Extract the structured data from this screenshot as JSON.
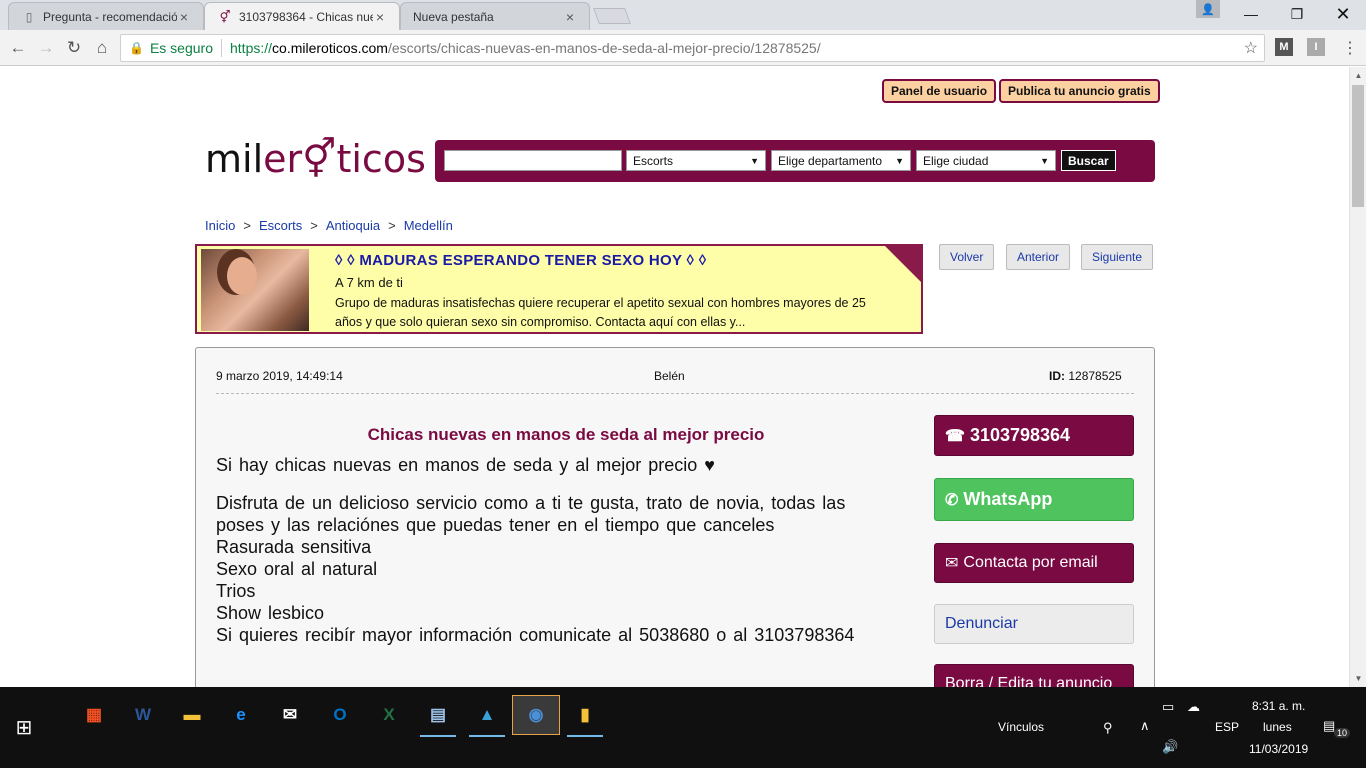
{
  "browser": {
    "tabs": [
      {
        "title": "Pregunta - recomendació",
        "favicon": "page-icon",
        "active": false
      },
      {
        "title": "3103798364 - Chicas nue",
        "favicon": "gender-icon",
        "active": true
      },
      {
        "title": "Nueva pestaña",
        "favicon": "none",
        "active": false
      }
    ],
    "close_glyph": "×",
    "secure_label": "Es seguro",
    "url_scheme": "https://",
    "url_host": "co.mileroticos.com",
    "url_path": "/escorts/chicas-nuevas-en-manos-de-seda-al-mejor-precio/12878525/",
    "extensions": [
      "M",
      "I"
    ]
  },
  "header": {
    "user_panel": "Panel de usuario",
    "publish": "Publica tu anuncio gratis",
    "logo_part1": "mil",
    "logo_part2": "er",
    "logo_part3": "ticos",
    "search": {
      "query": "",
      "category": "Escorts",
      "department": "Elige departamento",
      "city": "Elige ciudad",
      "button": "Buscar"
    }
  },
  "breadcrumb": [
    "Inicio",
    "Escorts",
    "Antioquia",
    "Medellín"
  ],
  "breadcrumb_sep": ">",
  "ad": {
    "title": "◊ ◊ MADURAS ESPERANDO TENER SEXO HOY ◊ ◊",
    "distance": "A 7 km de ti",
    "text": "Grupo de maduras insatisfechas quiere recuperar el apetito sexual con hombres mayores de 25 años y que solo quieran sexo sin compromiso. Contacta aquí con ellas y..."
  },
  "nav": {
    "back": "Volver",
    "prev": "Anterior",
    "next": "Siguiente"
  },
  "listing": {
    "date": "9 marzo 2019, 14:49:14",
    "name": "Belén",
    "id_label": "ID:",
    "id": "12878525",
    "title": "Chicas nuevas en manos de seda al mejor precio",
    "lines": [
      "Si hay chicas nuevas en manos de seda y al mejor precio ♥",
      "Disfruta de un delicioso servicio como a ti te gusta, trato de novia, todas las poses y las relaciónes que puedas tener en el tiempo que canceles",
      "Rasurada sensitiva",
      "Sexo oral al natural",
      "Trios",
      "Show lesbico",
      "Si quieres recibír mayor información comunicate al 5038680 o al 3103798364"
    ],
    "phone": "3103798364",
    "whatsapp": "WhatsApp",
    "email": "Contacta por email",
    "report": "Denunciar",
    "edit": "Borra / Edita tu anuncio"
  },
  "taskbar": {
    "links_label": "Vínculos",
    "lang": "ESP",
    "time": "8:31 a. m.",
    "day": "lunes",
    "date": "11/03/2019",
    "notifications": "10"
  },
  "colors": {
    "brand": "#7a0a42",
    "whatsapp": "#4fc45e",
    "link": "#1a3aa8",
    "ad_bg": "#fffea8"
  }
}
